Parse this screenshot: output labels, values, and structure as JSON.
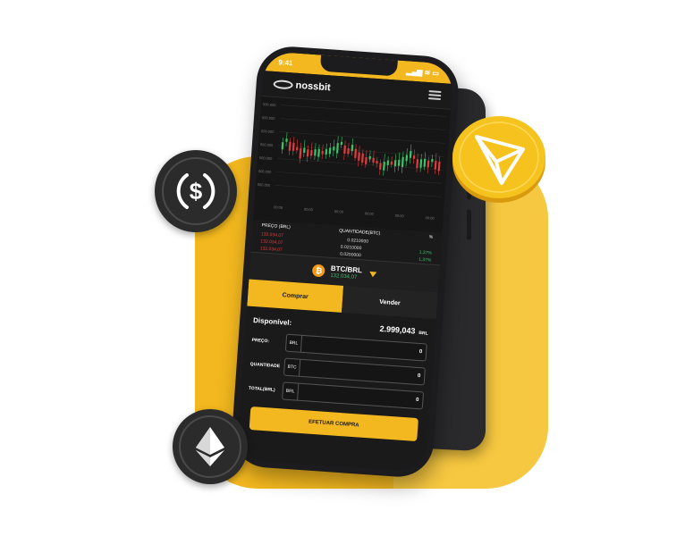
{
  "status": {
    "time": "9:41"
  },
  "nav": {
    "brand": "nossbit"
  },
  "chart_data": {
    "type": "candlestick",
    "y_ticks": [
      "000.000",
      "000.000",
      "000.000",
      "000.000",
      "000.000",
      "000.000",
      "000.000"
    ],
    "x_ticks": [
      "00:00",
      "00:00",
      "00:00",
      "00:00",
      "00:00",
      "00:00"
    ],
    "colors": {
      "up": "#3cc36a",
      "down": "#e23b3b"
    }
  },
  "orderbook": {
    "headers": {
      "price": "PREÇO (BRL)",
      "qty": "QUANTIDADE(BTC)",
      "pct": "%"
    },
    "rows": [
      {
        "price": "132.034,07",
        "qty": "0.0210000",
        "pct": ""
      },
      {
        "price": "132.034,07",
        "qty": "0.0210000",
        "pct": "1,37%"
      },
      {
        "price": "132.034,07",
        "qty": "0.0200000",
        "pct": "1,37%"
      }
    ]
  },
  "pair": {
    "coin_symbol": "₿",
    "name": "BTC/BRL",
    "price": "132.034,07"
  },
  "tabs": {
    "buy": "Comprar",
    "sell": "Vender"
  },
  "form": {
    "available_label": "Disponível:",
    "available_value": "2.999,043",
    "available_unit": "BRL",
    "fields": [
      {
        "label": "PREÇO:",
        "unit": "BRL",
        "value": "0"
      },
      {
        "label": "QUANTIDADE",
        "unit": "BTC",
        "value": "0"
      },
      {
        "label": "TOTAL(BRL)",
        "unit": "BRL",
        "value": "0"
      }
    ],
    "submit": "EFETUAR COMPRA"
  },
  "coins": {
    "usdc_icon": "usdc-icon",
    "tron_icon": "tron-icon",
    "eth_icon": "ethereum-icon"
  },
  "colors": {
    "accent": "#f3b81f",
    "up": "#3cc36a",
    "down": "#e23b3b"
  }
}
